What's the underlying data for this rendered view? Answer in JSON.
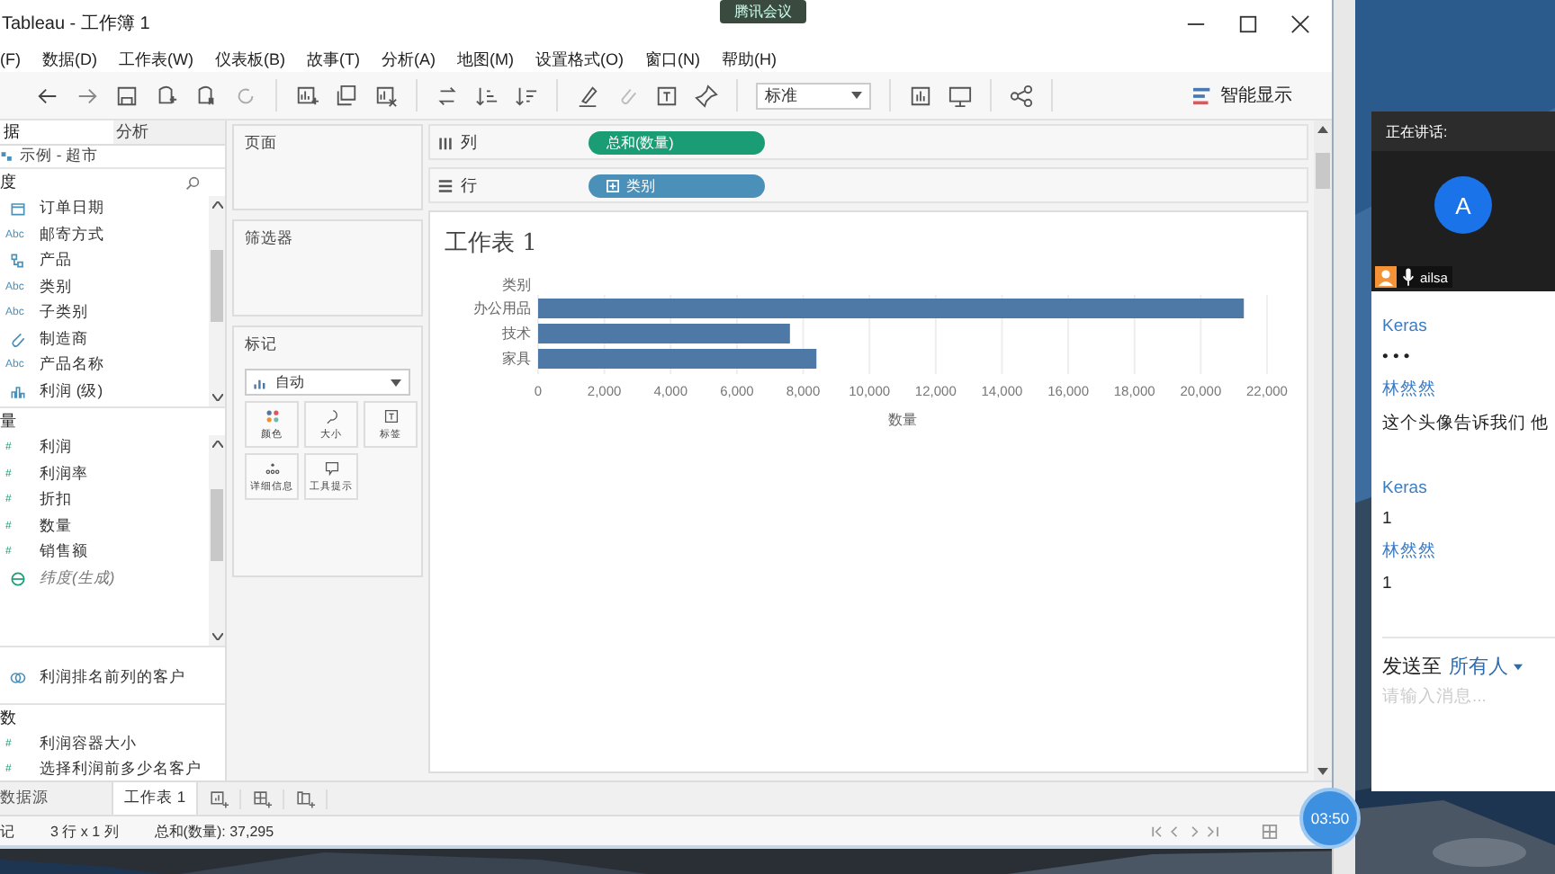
{
  "meeting_tag": "腾讯会议",
  "window": {
    "title": "Tableau - 工作簿 1"
  },
  "menu": [
    "(F)",
    "数据(D)",
    "工作表(W)",
    "仪表板(B)",
    "故事(T)",
    "分析(A)",
    "地图(M)",
    "设置格式(O)",
    "窗口(N)",
    "帮助(H)"
  ],
  "toolbar": {
    "view_size": "标准",
    "show_me": "智能显示"
  },
  "data_pane": {
    "tabs": [
      {
        "label": "据",
        "selected": true
      },
      {
        "label": "分析",
        "selected": false
      }
    ],
    "source": "示例 - 超市",
    "sections": [
      {
        "title": "度",
        "kind": "dimensions",
        "fields": [
          {
            "label": "订单日期",
            "kind": "date"
          },
          {
            "label": "邮寄方式",
            "kind": "string",
            "badge": "Abc"
          },
          {
            "label": "产品",
            "kind": "hierarchy"
          },
          {
            "label": "类别",
            "kind": "string",
            "badge": "Abc"
          },
          {
            "label": "子类别",
            "kind": "string",
            "badge": "Abc"
          },
          {
            "label": "制造商",
            "kind": "group"
          },
          {
            "label": "产品名称",
            "kind": "string",
            "badge": "Abc"
          },
          {
            "label": "利润 (级)",
            "kind": "bin"
          }
        ]
      },
      {
        "title": "量",
        "kind": "measures",
        "fields": [
          {
            "label": "利润",
            "kind": "measure",
            "badge": "#"
          },
          {
            "label": "利润率",
            "kind": "measure",
            "badge": "#"
          },
          {
            "label": "折扣",
            "kind": "measure",
            "badge": "#"
          },
          {
            "label": "数量",
            "kind": "measure",
            "badge": "#"
          },
          {
            "label": "销售额",
            "kind": "measure",
            "badge": "#"
          },
          {
            "label": "纬度(生成)",
            "kind": "generated"
          }
        ]
      },
      {
        "kind": "sets",
        "fields": [
          {
            "label": "利润排名前列的客户",
            "kind": "set"
          }
        ]
      },
      {
        "title": "数",
        "kind": "parameters",
        "fields": [
          {
            "label": "利润容器大小",
            "kind": "measure",
            "badge": "#"
          },
          {
            "label": "选择利润前多少名客户",
            "kind": "measure",
            "badge": "#"
          }
        ]
      }
    ]
  },
  "cards": {
    "pages": "页面",
    "filters": "筛选器",
    "marks": {
      "title": "标记",
      "type": "自动",
      "buttons": [
        {
          "label": "颜色",
          "kind": "color"
        },
        {
          "label": "大小",
          "kind": "size"
        },
        {
          "label": "标签",
          "kind": "label"
        },
        {
          "label": "详细信息",
          "kind": "detail"
        },
        {
          "label": "工具提示",
          "kind": "tooltip"
        }
      ]
    }
  },
  "shelves": [
    {
      "label": "列",
      "kind": "columns",
      "pill": "总和(数量)",
      "color": "#1a9c74"
    },
    {
      "label": "行",
      "kind": "rows",
      "pill": "类别",
      "color": "#4a90b8"
    }
  ],
  "sheet": {
    "title": "工作表 1",
    "chart_data": {
      "type": "bar",
      "orientation": "horizontal",
      "title": "类别",
      "xlabel": "数量",
      "categories": [
        "办公用品",
        "技术",
        "家具"
      ],
      "values": [
        21300,
        7600,
        8400
      ],
      "grid": true,
      "xlim": [
        0,
        22000
      ],
      "xticks": [
        {
          "value": 0,
          "label": "0"
        },
        {
          "value": 2000,
          "label": "2,000"
        },
        {
          "value": 4000,
          "label": "4,000"
        },
        {
          "value": 6000,
          "label": "6,000"
        },
        {
          "value": 8000,
          "label": "8,000"
        },
        {
          "value": 10000,
          "label": "10,000"
        },
        {
          "value": 12000,
          "label": "12,000"
        },
        {
          "value": 14000,
          "label": "14,000"
        },
        {
          "value": 16000,
          "label": "16,000"
        },
        {
          "value": 18000,
          "label": "18,000"
        },
        {
          "value": 20000,
          "label": "20,000"
        },
        {
          "value": 22000,
          "label": "22,000"
        }
      ]
    }
  },
  "sheet_tabs": [
    {
      "label": "数据源",
      "selected": false
    },
    {
      "label": "工作表 1",
      "selected": true
    }
  ],
  "status_bar": [
    "记",
    "3 行 x 1 列",
    "总和(数量): 37,295"
  ],
  "meeting": {
    "speaking_label": "正在讲话:",
    "avatar": "A",
    "speaker": "ailsa",
    "messages": [
      {
        "sender": "Keras",
        "text": "• • •"
      },
      {
        "sender": "林然然",
        "text": "这个头像告诉我们 他"
      },
      {
        "sender": "Keras",
        "text": "1"
      },
      {
        "sender": "林然然",
        "text": "1"
      }
    ],
    "send_to": "发送至",
    "recipient": "所有人",
    "placeholder": "请输入消息..."
  },
  "timer": "03:50"
}
